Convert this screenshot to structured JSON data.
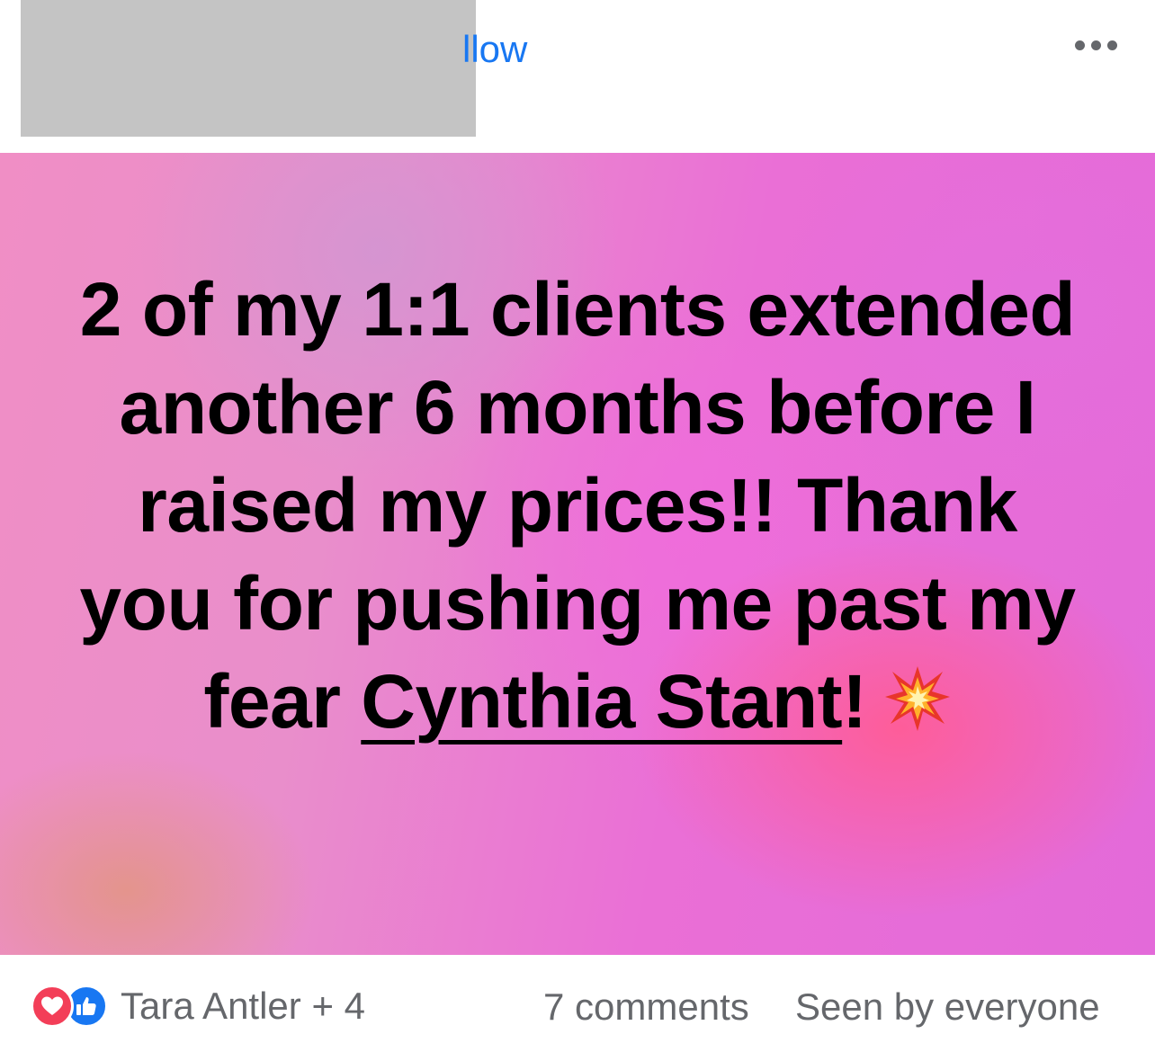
{
  "header": {
    "follow_label": "llow",
    "more_icon": "more-horizontal-icon"
  },
  "post": {
    "text_before": "2 of my 1:1 clients extended another 6 months before I raised my prices!!  Thank you for pushing me past my fear ",
    "mention": "Cynthia Stant",
    "text_after": "!",
    "emoji": "collision-emoji",
    "background_colors": [
      "#f08ec5",
      "#ea6fd6",
      "#ff5c96"
    ]
  },
  "footer": {
    "reaction_icons": [
      "love-reaction-icon",
      "like-reaction-icon"
    ],
    "reaction_summary": "Tara Antler + 4",
    "comments": "7 comments",
    "seen": "Seen by everyone"
  },
  "colors": {
    "link": "#1877f2",
    "secondary_text": "#65676b",
    "love": "#f33e58",
    "like": "#1877f2"
  }
}
